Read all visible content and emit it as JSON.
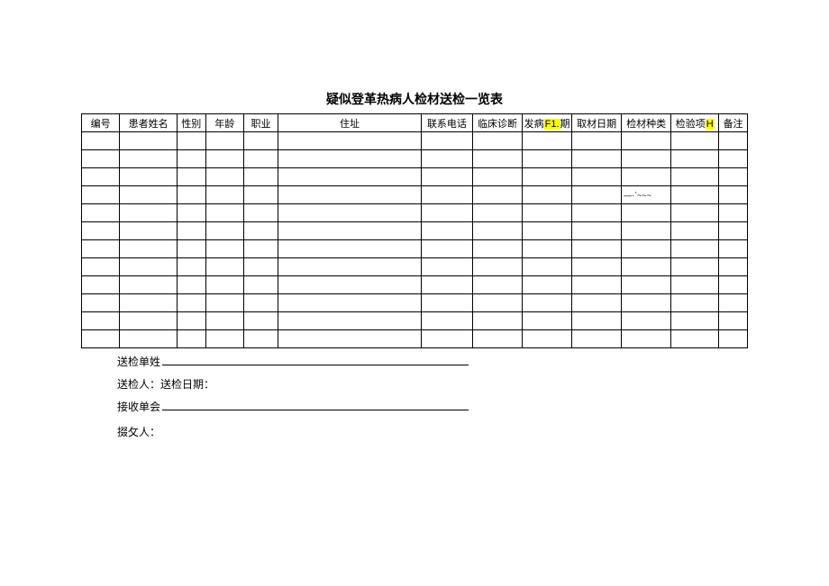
{
  "title": "疑似登革热病人检材送检一览表",
  "headers": {
    "c0": "编号",
    "c1": "患者姓名",
    "c2": "性别",
    "c3": "年龄",
    "c4": "职业",
    "c5": "住址",
    "c6": "联系电话",
    "c7": "临床诊断",
    "c8_pre": "发病",
    "c8_hl": "F1.",
    "c8_post": "期",
    "c9": "取材日期",
    "c10": "检材种类",
    "c11_pre": "检验项",
    "c11_hl": "H",
    "c12": "备注"
  },
  "rows": [
    {
      "c0": "",
      "c1": "",
      "c2": "",
      "c3": "",
      "c4": "",
      "c5": "",
      "c6": "",
      "c7": "",
      "c8": "",
      "c9": "",
      "c10": "",
      "c11": "",
      "c12": ""
    },
    {
      "c0": "",
      "c1": "",
      "c2": "",
      "c3": "",
      "c4": "",
      "c5": "",
      "c6": "",
      "c7": "",
      "c8": "",
      "c9": "",
      "c10": "",
      "c11": "",
      "c12": ""
    },
    {
      "c0": "",
      "c1": "",
      "c2": "",
      "c3": "",
      "c4": "",
      "c5": "",
      "c6": "",
      "c7": "",
      "c8": "",
      "c9": "",
      "c10": "",
      "c11": "",
      "c12": ""
    },
    {
      "c0": "",
      "c1": "",
      "c2": "",
      "c3": "",
      "c4": "",
      "c5": "",
      "c6": "",
      "c7": "",
      "c8": "",
      "c9": "",
      "c10": "—·`~~~",
      "c11": "",
      "c12": ""
    },
    {
      "c0": "",
      "c1": "",
      "c2": "",
      "c3": "",
      "c4": "",
      "c5": "",
      "c6": "",
      "c7": "",
      "c8": "",
      "c9": "",
      "c10": "",
      "c11": "",
      "c12": ""
    },
    {
      "c0": "",
      "c1": "",
      "c2": "",
      "c3": "",
      "c4": "",
      "c5": "",
      "c6": "",
      "c7": "",
      "c8": "",
      "c9": "",
      "c10": "",
      "c11": "",
      "c12": ""
    },
    {
      "c0": "",
      "c1": "",
      "c2": "",
      "c3": "",
      "c4": "",
      "c5": "",
      "c6": "",
      "c7": "",
      "c8": "",
      "c9": "",
      "c10": "",
      "c11": "",
      "c12": ""
    },
    {
      "c0": "",
      "c1": "",
      "c2": "",
      "c3": "",
      "c4": "",
      "c5": "",
      "c6": "",
      "c7": "",
      "c8": "",
      "c9": "",
      "c10": "",
      "c11": "",
      "c12": ""
    },
    {
      "c0": "",
      "c1": "",
      "c2": "",
      "c3": "",
      "c4": "",
      "c5": "",
      "c6": "",
      "c7": "",
      "c8": "",
      "c9": "",
      "c10": "",
      "c11": "",
      "c12": ""
    },
    {
      "c0": "",
      "c1": "",
      "c2": "",
      "c3": "",
      "c4": "",
      "c5": "",
      "c6": "",
      "c7": "",
      "c8": "",
      "c9": "",
      "c10": "",
      "c11": "",
      "c12": ""
    },
    {
      "c0": "",
      "c1": "",
      "c2": "",
      "c3": "",
      "c4": "",
      "c5": "",
      "c6": "",
      "c7": "",
      "c8": "",
      "c9": "",
      "c10": "",
      "c11": "",
      "c12": ""
    },
    {
      "c0": "",
      "c1": "",
      "c2": "",
      "c3": "",
      "c4": "",
      "c5": "",
      "c6": "",
      "c7": "",
      "c8": "",
      "c9": "",
      "c10": "",
      "c11": "",
      "c12": ""
    }
  ],
  "footer": {
    "line1": "送检单姓",
    "line2a": "送检人：",
    "line2b": "送检日期：",
    "line3": "接收单会",
    "line4": "掇攵人："
  }
}
